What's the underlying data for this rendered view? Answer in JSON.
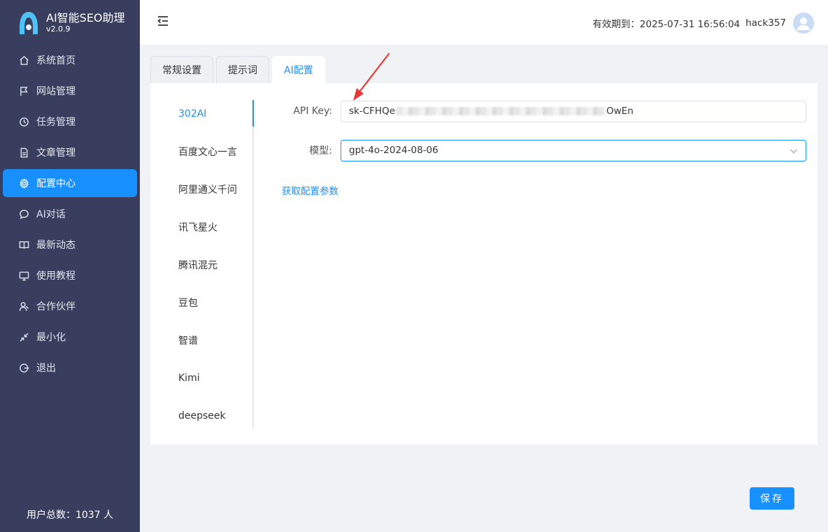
{
  "brand": {
    "title": "AI智能SEO助理",
    "version": "v2.0.9"
  },
  "sidebar": {
    "items": [
      {
        "label": "系统首页",
        "icon": "home-icon"
      },
      {
        "label": "网站管理",
        "icon": "flag-icon"
      },
      {
        "label": "任务管理",
        "icon": "clock-icon"
      },
      {
        "label": "文章管理",
        "icon": "document-icon"
      },
      {
        "label": "配置中心",
        "icon": "gear-icon",
        "active": true
      },
      {
        "label": "AI对话",
        "icon": "chat-icon"
      },
      {
        "label": "最新动态",
        "icon": "book-icon"
      },
      {
        "label": "使用教程",
        "icon": "monitor-icon"
      },
      {
        "label": "合作伙伴",
        "icon": "partner-icon"
      },
      {
        "label": "最小化",
        "icon": "minimize-icon"
      },
      {
        "label": "退出",
        "icon": "logout-icon"
      }
    ],
    "user_count": "用户总数：1037 人"
  },
  "header": {
    "expiry": "有效期到：2025-07-31 16:56:04",
    "username": "hack357"
  },
  "tabs": [
    {
      "label": "常规设置"
    },
    {
      "label": "提示词"
    },
    {
      "label": "AI配置",
      "active": true
    }
  ],
  "providers": [
    {
      "label": "302AI",
      "active": true
    },
    {
      "label": "百度文心一言"
    },
    {
      "label": "阿里通义千问"
    },
    {
      "label": "讯飞星火"
    },
    {
      "label": "腾讯混元"
    },
    {
      "label": "豆包"
    },
    {
      "label": "智谱"
    },
    {
      "label": "Kimi"
    },
    {
      "label": "deepseek"
    }
  ],
  "form": {
    "api_key_label": "API Key:",
    "api_key_prefix": "sk-CFHQe",
    "api_key_suffix": "OwEn",
    "model_label": "模型:",
    "model_value": "gpt-4o-2024-08-06",
    "help_link": "获取配置参数"
  },
  "save_label": "保存",
  "colors": {
    "sidebar_bg": "#3a3e5e",
    "accent": "#1890ff",
    "annotation_arrow": "#e53935"
  }
}
